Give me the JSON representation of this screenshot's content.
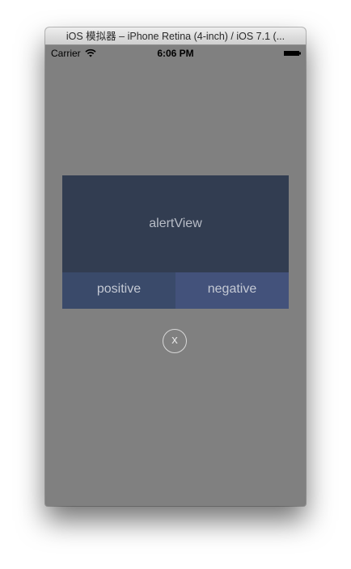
{
  "window": {
    "title": "iOS 模拟器 – iPhone Retina (4-inch) / iOS 7.1 (..."
  },
  "status_bar": {
    "carrier": "Carrier",
    "time": "6:06 PM",
    "wifi_icon": "wifi-icon",
    "battery_icon": "battery-icon"
  },
  "alert": {
    "body_text": "alertView",
    "positive_label": "positive",
    "negative_label": "negative"
  },
  "close_button": {
    "label": "x"
  },
  "colors": {
    "overlay_background": "#808080",
    "alert_body": "#323d51",
    "positive_button": "#3a4a6a",
    "negative_button": "#43527b"
  }
}
